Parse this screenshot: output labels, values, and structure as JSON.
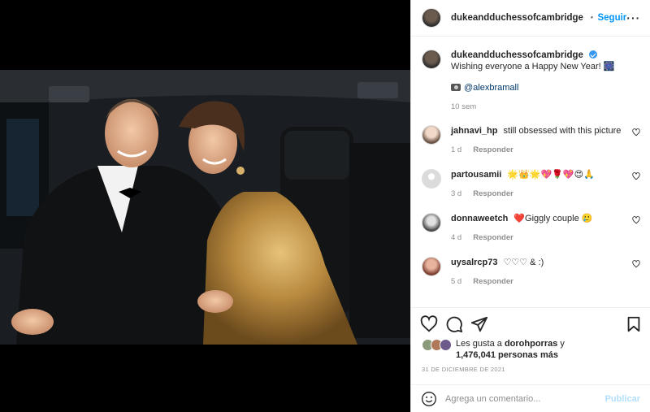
{
  "post": {
    "username": "dukeandduchessofcambridge",
    "follow_label": "Seguir",
    "more_label": "···"
  },
  "caption": {
    "username": "dukeandduchessofcambridge",
    "text": "Wishing everyone a Happy New Year! 🎆",
    "credit": "@alexbramall",
    "time": "10 sem"
  },
  "comments": [
    {
      "username": "jahnavi_hp",
      "text": "still obsessed with this picture",
      "time": "1 d",
      "reply": "Responder",
      "avatar_color": "#c9b7ad"
    },
    {
      "username": "partousamii",
      "text": "🌟👑🌟💖🌹💖😍🙏",
      "time": "3 d",
      "reply": "Responder",
      "avatar_color": "#dbdbdb"
    },
    {
      "username": "donnaweetch",
      "text": "❤️Giggly couple 🥲",
      "time": "4 d",
      "reply": "Responder",
      "avatar_color": "#6d6d6d"
    },
    {
      "username": "uysalrcp73",
      "text": "♡♡♡ & :)",
      "time": "5 d",
      "reply": "Responder",
      "avatar_color": "#c47b6a"
    }
  ],
  "likes": {
    "prefix": "Les gusta a",
    "user": "dorohporras",
    "connector": "y",
    "others": "1,476,041 personas más"
  },
  "date": "31 de diciembre de 2021",
  "add_comment": {
    "placeholder": "Agrega un comentario...",
    "publish_label": "Publicar"
  },
  "colors": {
    "accent": "#0095f6",
    "verified": "#3897f0",
    "publish_disabled": "#b2dffc",
    "muted": "#8e8e8e"
  }
}
